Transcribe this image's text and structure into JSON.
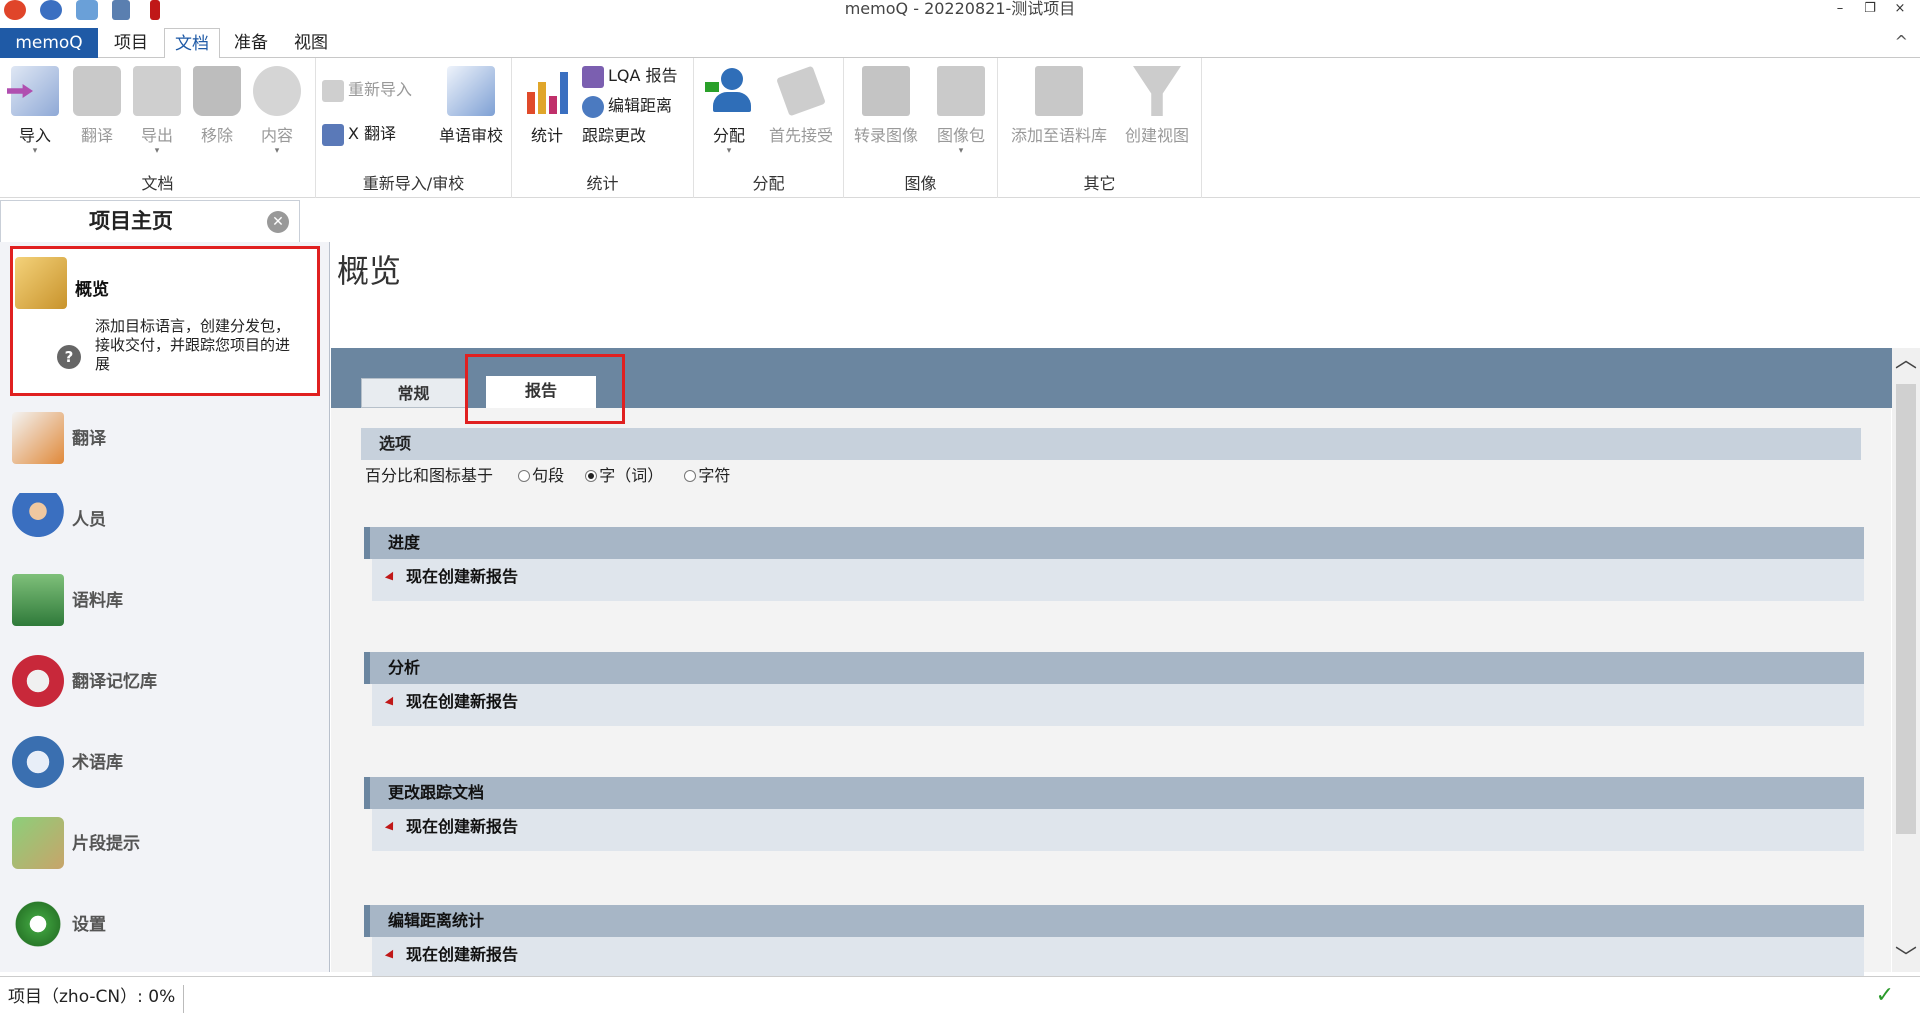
{
  "window": {
    "title": "memoQ - 20220821-测试项目",
    "minimize": "–",
    "restore": "❐",
    "close": "×"
  },
  "menu": {
    "tabs": [
      "memoQ",
      "项目",
      "文档",
      "准备",
      "视图"
    ],
    "active": "文档",
    "collapse": "^"
  },
  "ribbon": {
    "groups": {
      "document": {
        "label": "文档",
        "buttons": [
          "导入",
          "翻译",
          "导出",
          "移除",
          "内容"
        ]
      },
      "reimport": {
        "label": "重新导入/审校",
        "small": [
          "重新导入",
          "X 翻译"
        ],
        "big": "单语审校"
      },
      "stats": {
        "label": "统计",
        "big": "统计",
        "small": [
          "LQA 报告",
          "编辑距离",
          "跟踪更改"
        ]
      },
      "assign": {
        "label": "分配",
        "buttons": [
          "分配",
          "首先接受"
        ]
      },
      "image": {
        "label": "图像",
        "buttons": [
          "转录图像",
          "图像包"
        ]
      },
      "other": {
        "label": "其它",
        "buttons": [
          "添加至语料库",
          "创建视图"
        ]
      }
    }
  },
  "sidebar": {
    "title": "项目主页",
    "close_icon": "close-icon",
    "overview": {
      "label": "概览",
      "description": "添加目标语言，创建分发包，接收交付，并跟踪您项目的进展",
      "help": "?"
    },
    "items": [
      "翻译",
      "人员",
      "语料库",
      "翻译记忆库",
      "术语库",
      "片段提示",
      "设置"
    ]
  },
  "main": {
    "title": "概览",
    "tabs": [
      "常规",
      "报告"
    ],
    "active_tab": "报告",
    "options": {
      "header": "选项",
      "basis_label": "百分比和图标基于",
      "choices": [
        "句段",
        "字（词）",
        "字符"
      ],
      "selected": "字（词）"
    },
    "sections": [
      {
        "header": "进度",
        "link": "现在创建新报告"
      },
      {
        "header": "分析",
        "link": "现在创建新报告"
      },
      {
        "header": "更改跟踪文档",
        "link": "现在创建新报告"
      },
      {
        "header": "编辑距离统计",
        "link": "现在创建新报告"
      }
    ]
  },
  "status": {
    "text": "项目（zho-CN）: 0%",
    "ok": "✓"
  },
  "colors": {
    "accent": "#1f5aa6",
    "tabstrip": "#6b86a0",
    "highlight": "#e02020"
  }
}
